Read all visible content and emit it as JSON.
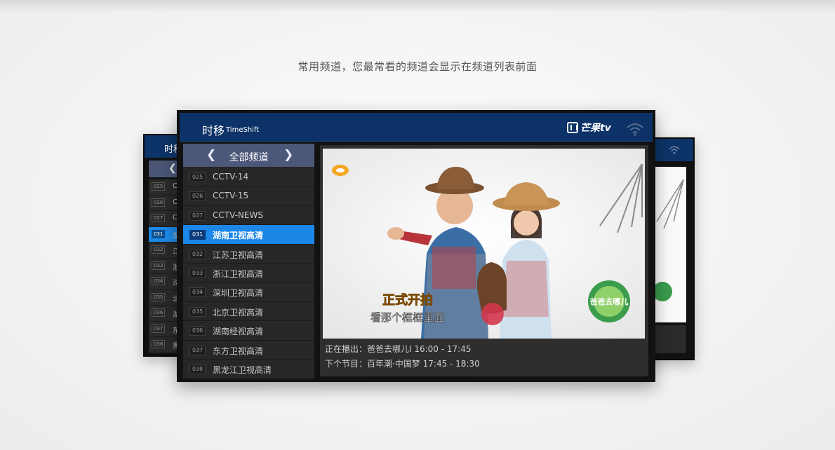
{
  "caption": "常用频道，您最常看的频道会显示在频道列表前面",
  "header": {
    "title": "时移",
    "subtitle": "TimeShift",
    "logo_text": "芒果tv"
  },
  "back_left": {
    "title": "时移",
    "rows": [
      {
        "num": "025",
        "name": "C"
      },
      {
        "num": "026",
        "name": "C"
      },
      {
        "num": "027",
        "name": "C"
      },
      {
        "num": "031",
        "name": "湖",
        "selected": true
      },
      {
        "num": "032",
        "name": "江"
      },
      {
        "num": "033",
        "name": "浙"
      },
      {
        "num": "034",
        "name": "深"
      },
      {
        "num": "035",
        "name": "北"
      },
      {
        "num": "036",
        "name": "湖"
      },
      {
        "num": "037",
        "name": "东"
      },
      {
        "num": "038",
        "name": "黑"
      }
    ]
  },
  "nav": {
    "title": "全部频道"
  },
  "channels": [
    {
      "num": "025",
      "name": "CCTV-14"
    },
    {
      "num": "026",
      "name": "CCTV-15"
    },
    {
      "num": "027",
      "name": "CCTV-NEWS"
    },
    {
      "num": "031",
      "name": "湖南卫视高清",
      "selected": true
    },
    {
      "num": "032",
      "name": "江苏卫视高清"
    },
    {
      "num": "033",
      "name": "浙江卫视高清"
    },
    {
      "num": "034",
      "name": "深圳卫视高清"
    },
    {
      "num": "035",
      "name": "北京卫视高清"
    },
    {
      "num": "036",
      "name": "湖南经视高清"
    },
    {
      "num": "037",
      "name": "东方卫视高清"
    },
    {
      "num": "038",
      "name": "黑龙江卫视高清"
    }
  ],
  "video": {
    "subtitle_tag": "正式开拍",
    "subtitle_line": "看那个框框里面",
    "show_logo_text": "爸爸去哪儿"
  },
  "program": {
    "now": "正在播出：爸爸去哪儿Ⅰ   16:00 - 17:45",
    "next": "下个节目：百年潮·中国梦   17:45 - 18:30"
  },
  "colors": {
    "header_blue": "#0c3267",
    "selected_blue": "#1d87e8",
    "nav_bar": "#4c5879"
  },
  "icons": [
    "chevron-left-icon",
    "chevron-right-icon",
    "wifi-icon",
    "mango-tv-logo-icon"
  ]
}
